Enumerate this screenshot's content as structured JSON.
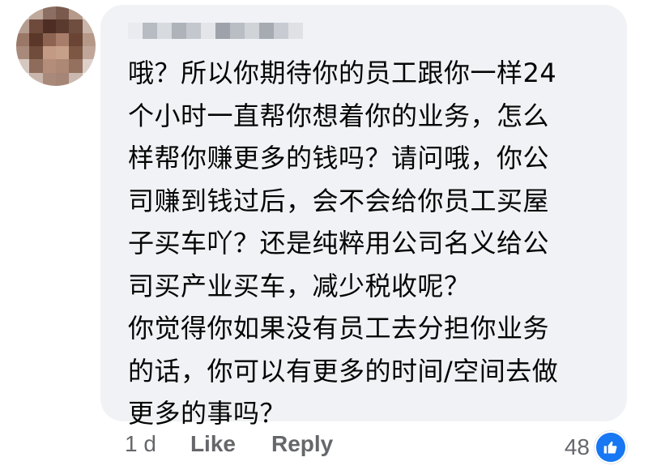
{
  "comment": {
    "lines": [
      "哦？所以你期待你的员工跟你一样24",
      "个小时一直帮你想着你的业务，怎么",
      "样帮你赚更多的钱吗？请问哦，你公",
      "司赚到钱过后，会不会给你员工买屋",
      "子买车吖？还是纯粹用公司名义给公",
      "司买产业买车，减少税收呢？",
      "你觉得你如果没有员工去分担你业务",
      "的话，你可以有更多的时间/空间去做",
      "更多的事吗？"
    ]
  },
  "actions": {
    "timestamp": "1 d",
    "like_label": "Like",
    "reply_label": "Reply"
  },
  "reactions": {
    "count": "48",
    "icon": "thumbs-up-icon"
  },
  "colors": {
    "bubble": "#f0f2f5",
    "text": "#050505",
    "meta": "#65676b",
    "like_blue": "#1877f2"
  }
}
